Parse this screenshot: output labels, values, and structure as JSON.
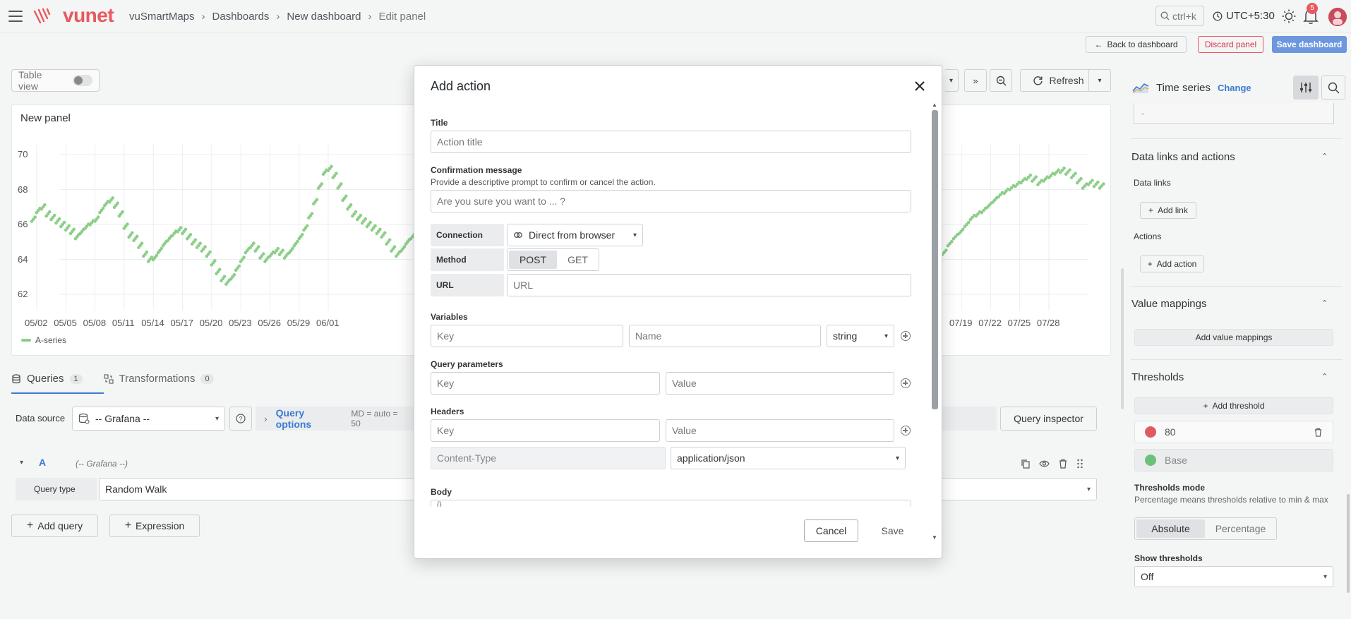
{
  "nav": {
    "logo": "vunet",
    "breadcrumb": [
      "vuSmartMaps",
      "Dashboards",
      "New dashboard",
      "Edit panel"
    ],
    "search_hint": "ctrl+k",
    "timezone": "UTC+5:30",
    "notification_count": "5"
  },
  "toolbar": {
    "back": "Back to dashboard",
    "discard": "Discard panel",
    "save": "Save dashboard",
    "refresh": "Refresh",
    "table_view": "Table view"
  },
  "panel": {
    "title": "New panel",
    "legend": "A-series"
  },
  "chart_data": {
    "type": "scatter",
    "title": "New panel",
    "xlabel": "",
    "ylabel": "",
    "ylim": [
      61.5,
      70.5
    ],
    "y_ticks": [
      "70",
      "68",
      "66",
      "64",
      "62"
    ],
    "x_ticks_left": [
      "05/02",
      "05/05",
      "05/08",
      "05/11",
      "05/14",
      "05/17",
      "05/20",
      "05/23",
      "05/26",
      "05/29",
      "06/01"
    ],
    "x_ticks_right": [
      "07/19",
      "07/22",
      "07/25",
      "07/28"
    ],
    "series": [
      {
        "name": "A-series",
        "color": "#8ccf88",
        "left_x_range": [
          "05/02",
          "06/03"
        ],
        "left_values": [
          66.3,
          66.8,
          67.0,
          66.6,
          66.4,
          66.2,
          66.0,
          65.8,
          65.6,
          65.3,
          65.6,
          65.9,
          66.1,
          66.3,
          66.8,
          67.2,
          67.4,
          67.1,
          66.6,
          65.9,
          65.4,
          65.2,
          64.8,
          64.3,
          64.0,
          64.1,
          64.5,
          64.9,
          65.2,
          65.5,
          65.7,
          65.6,
          65.3,
          65.0,
          64.8,
          64.6,
          64.3,
          63.8,
          63.3,
          62.9,
          62.7,
          63.0,
          63.5,
          64.0,
          64.5,
          64.8,
          64.6,
          64.2,
          64.0,
          64.3,
          64.5,
          64.4,
          64.2,
          64.5,
          64.9,
          65.3,
          65.8,
          66.5,
          67.3,
          68.2,
          69.0,
          69.2,
          68.8,
          68.2,
          67.5,
          67.0,
          66.6,
          66.4,
          66.2,
          66.0,
          65.8,
          65.6,
          65.4,
          65.0,
          64.6,
          64.3,
          64.6,
          65.0,
          65.3
        ],
        "right_x_range": [
          "07/16",
          "07/31"
        ],
        "right_values": [
          64.4,
          64.9,
          65.3,
          65.6,
          66.0,
          66.4,
          66.6,
          66.8,
          67.1,
          67.4,
          67.7,
          67.9,
          68.1,
          68.3,
          68.5,
          68.7,
          68.6,
          68.4,
          68.6,
          68.8,
          69.0,
          69.1,
          69.0,
          68.8,
          68.5,
          68.2,
          68.4,
          68.3,
          68.2
        ]
      }
    ]
  },
  "queries": {
    "tab_queries": "Queries",
    "tab_queries_count": "1",
    "tab_transformations": "Transformations",
    "tab_transformations_count": "0",
    "datasource_label": "Data source",
    "datasource": "-- Grafana --",
    "options_label": "Query options",
    "options_meta": "MD = auto = 50",
    "inspector": "Query inspector",
    "query_letter": "A",
    "query_ds": "(-- Grafana --)",
    "query_type_label": "Query type",
    "query_type": "Random Walk",
    "add_query": "Add query",
    "add_expression": "Expression"
  },
  "sidebar": {
    "viz_name": "Time series",
    "change": "Change",
    "top_input": "-",
    "links_title": "Data links and actions",
    "data_links": "Data links",
    "add_link": "Add link",
    "actions": "Actions",
    "add_action": "Add action",
    "value_mappings_title": "Value mappings",
    "add_value_mappings": "Add value mappings",
    "thresholds_title": "Thresholds",
    "add_threshold": "Add threshold",
    "threshold_1": "80",
    "threshold_1_color": "#e05a5f",
    "threshold_base": "Base",
    "threshold_base_color": "#6cc17a",
    "mode_label": "Thresholds mode",
    "mode_desc": "Percentage means thresholds relative to min & max",
    "mode_absolute": "Absolute",
    "mode_percentage": "Percentage",
    "show_label": "Show thresholds",
    "show_value": "Off"
  },
  "modal": {
    "title": "Add action",
    "title_label": "Title",
    "title_placeholder": "Action title",
    "confirm_label": "Confirmation message",
    "confirm_desc": "Provide a descriptive prompt to confirm or cancel the action.",
    "confirm_placeholder": "Are you sure you want to ... ?",
    "connection_label": "Connection",
    "connection_value": "Direct from browser",
    "method_label": "Method",
    "method_post": "POST",
    "method_get": "GET",
    "url_label": "URL",
    "url_placeholder": "URL",
    "variables_label": "Variables",
    "var_key_placeholder": "Key",
    "var_name_placeholder": "Name",
    "var_type": "string",
    "params_label": "Query parameters",
    "param_key_placeholder": "Key",
    "param_value_placeholder": "Value",
    "headers_label": "Headers",
    "header_key_placeholder": "Key",
    "header_value_placeholder": "Value",
    "content_type_key": "Content-Type",
    "content_type_value": "application/json",
    "body_label": "Body",
    "body_value": "{}",
    "cancel": "Cancel",
    "save": "Save"
  }
}
